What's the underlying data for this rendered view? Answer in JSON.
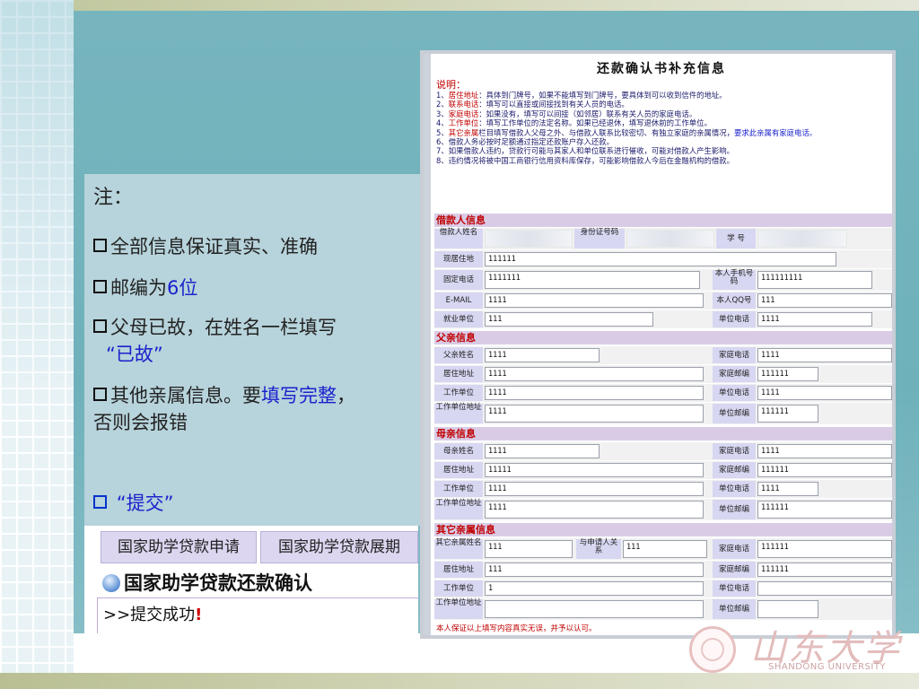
{
  "notes": {
    "title": "注：",
    "item1": "全部信息保证真实、准确",
    "item2_prefix": "邮编为",
    "item2_highlight": "6位",
    "item3_line1": "父母已故，在姓名一栏填写",
    "item3_highlight": "“已故”",
    "item4_prefix": "其他亲属信息。要",
    "item4_highlight": "填写完整",
    "item4_suffix": "，",
    "item4_line2": "否则会报错",
    "item5_highlight": "“提交”"
  },
  "app": {
    "tab1": "国家助学贷款申请",
    "tab2": "国家助学贷款展期",
    "heading": "国家助学贷款还款确认",
    "success_prefix": ">>提交成功",
    "success_mark": "!"
  },
  "form": {
    "title": "还款确认书补充信息",
    "instr_head": "说明：",
    "instructions": [
      {
        "n": "1、",
        "key": "居住地址",
        "text": "：具体到门牌号，如果不能填写到门牌号，要具体到可以收到信件的地址。"
      },
      {
        "n": "2、",
        "key": "联系电话",
        "text": "：填写可以直接或间接找到有关人员的电话。"
      },
      {
        "n": "3、",
        "key": "家庭电话",
        "text": "：如果没有，填写可以间接（如邻居）联系有关人员的家庭电话。"
      },
      {
        "n": "4、",
        "key": "工作单位",
        "text": "：填写工作单位的法定名称。如果已经退休，填写退休前的工作单位。"
      },
      {
        "n": "5、",
        "key": "其它亲属",
        "text": "栏目填写借款人父母之外、与借款人联系比较密切、有独立家庭的亲属情况，",
        "blue": "要求此亲属有家庭电话。"
      },
      {
        "n": "6、",
        "key": "",
        "text": "借款人务必按时足额通过指定还款账户存入还款。"
      },
      {
        "n": "7、",
        "key": "",
        "text": "如果借款人违约，贷款行可能与其家人和单位联系进行催收，可能对借款人产生影响。"
      },
      {
        "n": "8、",
        "key": "",
        "text": "违约情况将被中国工商银行信用资料库保存，可能影响借款人今后在金融机构的借款。"
      }
    ],
    "sec_borrower": "借款人信息",
    "sec_father": "父亲信息",
    "sec_mother": "母亲信息",
    "sec_other": "其它亲属信息",
    "borrower": {
      "name_label": "借款人姓名",
      "id_label": "身份证号码",
      "student_no_label": "学 号",
      "address_label": "现居住地",
      "address": "111111",
      "landline_label": "固定电话",
      "landline": "1111111",
      "mobile_label": "本人手机号码",
      "mobile": "111111111",
      "email_label": "E-MAIL",
      "email": "1111",
      "qq_label": "本人QQ号",
      "qq": "111",
      "employer_label": "就业单位",
      "employer": "111",
      "work_phone_label": "单位电话",
      "work_phone": "1111"
    },
    "father": {
      "name_label": "父亲姓名",
      "name": "1111",
      "home_phone_label": "家庭电话",
      "home_phone": "1111",
      "address_label": "居住地址",
      "address": "1111",
      "home_zip_label": "家庭邮编",
      "home_zip": "111111",
      "work_label": "工作单位",
      "work": "1111",
      "work_phone_label": "单位电话",
      "work_phone": "1111",
      "work_addr_label": "工作单位地址",
      "work_addr": "1111",
      "work_zip_label": "单位邮编",
      "work_zip": "111111"
    },
    "mother": {
      "name_label": "母亲姓名",
      "name": "1111",
      "home_phone_label": "家庭电话",
      "home_phone": "1111",
      "address_label": "居住地址",
      "address": "11111",
      "home_zip_label": "家庭邮编",
      "home_zip": "111111",
      "work_label": "工作单位",
      "work": "1111",
      "work_phone_label": "单位电话",
      "work_phone": "1111",
      "work_addr_label": "工作单位地址",
      "work_addr": "1111",
      "work_zip_label": "单位邮编",
      "work_zip": "111111"
    },
    "other": {
      "name_label": "其它亲属姓名",
      "name": "111",
      "relation_label": "与申请人关系",
      "relation": "111",
      "home_phone_label": "家庭电话",
      "home_phone": "111111",
      "address_label": "居住地址",
      "address": "111",
      "home_zip_label": "家庭邮编",
      "home_zip": "111111",
      "work_label": "工作单位",
      "work": "1",
      "work_phone_label": "单位电话",
      "work_phone": "",
      "work_addr_label": "工作单位地址",
      "work_addr": "",
      "work_zip_label": "单位邮编",
      "work_zip": ""
    },
    "footer": "本人保证以上填写内容真实无误，并予以认可。"
  },
  "logo": {
    "calligraphy": "山东大学",
    "english": "SHANDONG UNIVERSITY"
  }
}
